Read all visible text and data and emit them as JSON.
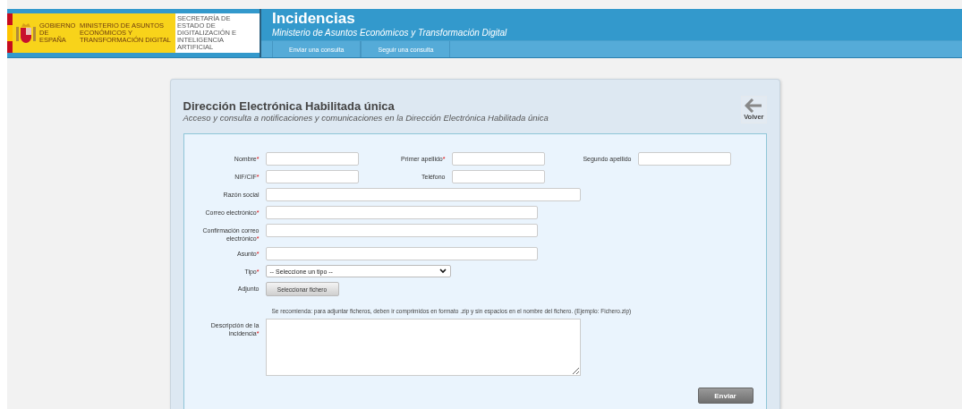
{
  "header": {
    "logo": {
      "government": "GOBIERNO DE ESPAÑA",
      "ministry": "MINISTERIO DE ASUNTOS ECONÓMICOS Y TRANSFORMACIÓN DIGITAL",
      "secretariat": "SECRETARÍA DE ESTADO DE DIGITALIZACIÓN E INTELIGENCIA ARTIFICIAL"
    },
    "title": "Incidencias",
    "subtitle": "Ministerio de Asuntos Económicos y Transformación Digital",
    "nav": [
      {
        "label": "Enviar una consulta"
      },
      {
        "label": "Seguir una consulta"
      }
    ]
  },
  "card": {
    "title": "Dirección Electrónica Habilitada única",
    "subtitle": "Acceso y consulta a notificaciones y comunicaciones en la Dirección Electrónica Habilitada única",
    "back": "Volver"
  },
  "form": {
    "rows": [
      [
        {
          "kind": "text",
          "label": "Nombre",
          "required": "*"
        },
        {
          "kind": "text",
          "label": "Primer apellido",
          "required": "*"
        },
        {
          "kind": "text",
          "label": "Segundo apellido"
        }
      ],
      [
        {
          "kind": "text",
          "label": "NIF/CIF",
          "required": "*"
        },
        {
          "kind": "text",
          "label": "Teléfono"
        }
      ],
      [
        {
          "kind": "wide",
          "label": "Razón social"
        }
      ],
      [
        {
          "kind": "text",
          "label": "Correo electrónico",
          "required": "*"
        }
      ],
      [
        {
          "kind": "text",
          "label": "Confirmación correo electrónico",
          "required": "*"
        }
      ],
      [
        {
          "kind": "text",
          "label": "Asunto",
          "required": "*"
        }
      ],
      [
        {
          "kind": "select",
          "label": "Tipo",
          "required": "*",
          "value": "-- Seleccione un tipo --"
        }
      ],
      [
        {
          "kind": "file",
          "label": "Adjunto",
          "button": "Seleccionar fichero"
        }
      ],
      [
        {
          "kind": "hint",
          "text": "Se recomienda: para adjuntar ficheros, deben ir comprimidos en formato .zip y sin espacios en el nombre del fichero. (Ejemplo: Fichero.zip)"
        }
      ],
      [
        {
          "kind": "textarea",
          "label": "Descripción de la incidencia",
          "required": "*"
        }
      ]
    ],
    "submit": "Enviar"
  }
}
